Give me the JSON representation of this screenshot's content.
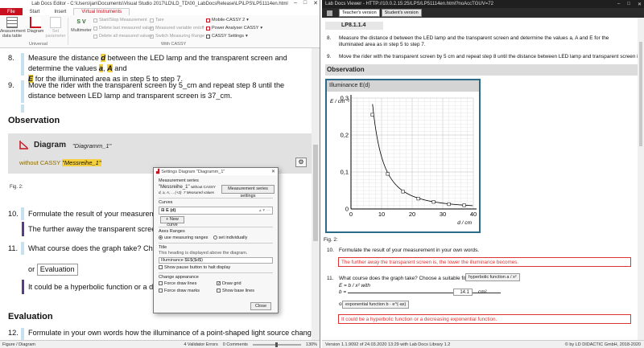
{
  "editor": {
    "title": "Lab Docs Editor - C:\\Users\\jan\\Documents\\Visual Studio 2017\\LD\\LD_TD\\00_LabDocsRelease\\LP\\LPS\\LP51114en.html",
    "tabs": [
      {
        "label": "File"
      },
      {
        "label": "Start"
      },
      {
        "label": "Insert"
      },
      {
        "label": "Virtual Instruments"
      }
    ],
    "ribbon": {
      "measurement_data_table": "Measurement data table",
      "diagram": "Diagram",
      "set_parameter": "Set parameter",
      "universal": "Universal",
      "multimeter": "Multimeter",
      "sv_label": "S V",
      "start_stop": "Start/Stop Measurement",
      "delete_last": "Delete last measured value",
      "delete_all": "Delete all measured values",
      "tare": "Tare",
      "measured_variable": "Measured variable on/off",
      "switch_range": "Switch Measuring Range",
      "with_cassy": "With CASSY",
      "mobile_cassy": "Mobile-CASSY 2",
      "power_analyser": "Power Analyser CASSY",
      "cassy_settings": "CASSY Settings"
    },
    "content": {
      "step8_num": "8.",
      "step8_pre": "Measure the distance ",
      "step8_d": "d",
      "step8_mid": " between the LED lamp and the transparent screen and determine the values ",
      "step8_a": "a",
      "step8_comma": ", ",
      "step8_A": "A",
      "step8_and": " and",
      "step8_E": "E",
      "step8_post": " for the illuminated area as in step 5 to step 7.",
      "step9_num": "9.",
      "step9_text": "Move the rider with the transparent screen by 5_cm and repeat step 8 until the distance between LED lamp and transparent screen is 37_cm.",
      "observation": "Observation",
      "diagram_title": "Diagram",
      "diagram_name": "\"Diagramm_1\"",
      "without_cassy": "without CASSY",
      "messreihe": "\"Messreihe_1\"",
      "fig2": "Fig. 2:",
      "step10_num": "10.",
      "step10_text": "Formulate the result of your measurement in y",
      "step10_answer": "The further away the transparent screen is, the",
      "step11_num": "11.",
      "step11_text": "What course does the graph take? Choose a su",
      "or_label": "or",
      "evaluation_box": "Evaluation",
      "step11_answer": "It could be a hyperbolic function or a decreasing",
      "evaluation": "Evaluation",
      "step12_num": "12.",
      "step12_text": "Formulate in your own words how the illuminance of a point-shaped light source changes depending on"
    },
    "status": {
      "left": "Figure / Diagram",
      "validator": "4 Validator Errors",
      "comments": "0 Comments",
      "zoom": "130%"
    }
  },
  "dialog": {
    "title": "Settings Diagram \"Diagramm_1\"",
    "measurement_series": "Measurement series",
    "series_name": "\"Messreihe_1\"",
    "series_without": "without CASSY",
    "series_vars": "d, a, A, ... (+2)",
    "series_count": "7 Measured values",
    "series_button": "Measurement series settings",
    "curves": "Curves",
    "curve_item": "E (d)",
    "new_curve": "+ New curve",
    "axes_ranges": "Axes Ranges",
    "use_ranges": "use measuring ranges",
    "set_individually": "set individually",
    "title_label": "Title",
    "title_hint": "This heading is displayed above the diagram.",
    "title_value": "Illuminance $E$($d$)",
    "show_pause": "Show pause button to halt display",
    "change_appearance": "Change appearance",
    "force_lines": "Force draw lines",
    "force_marks": "Force draw marks",
    "draw_grid": "Draw grid",
    "show_base": "Show base lines",
    "close": "Close"
  },
  "viewer": {
    "title": "Lab Docs Viewer - HTTP://10.0.2.15:25/LPS/LP51114en.html?noAccTGUV=72",
    "teacher_version": "Teacher's version",
    "student_version": "Student's version",
    "lp_number": "LP8.1.1.4",
    "step8_num": "8.",
    "step8_text": "Measure the distance d between the LED lamp and the transparent screen and determine the values a, A and E for the illuminated area as in step 5 to step 7.",
    "step9_num": "9.",
    "step9_text": "Move the rider with the transparent screen by 5 cm and repeat step 8 until the distance between LED lamp and transparent screen is 37 cm",
    "observation": "Observation",
    "chart_title": "Illuminance E(d)",
    "fig2": "Fig. 2:",
    "step10_num": "10.",
    "step10_text": "Formulate the result of your measurement in your own words.",
    "step10_answer": "The further away the transparent screen is, the lower the illuminance becomes.",
    "step11_num": "11.",
    "step11_text": "What course does the graph take? Choose a suitable fitting",
    "fit_button": "hyperbolic function a / x²",
    "formula": "E = b / x²  with",
    "b_label": "b =",
    "b_value": "14.1",
    "b_unit": "cm²",
    "or_label": "or",
    "exp_button": "exponential function b · e^(-ax)",
    "step11_answer": "It could be a hyperbolic function or a decreasing exponential function.",
    "status_left": "Version 1.1.9092 of 24.03.2020 13:29 with Lab Docs Library 1.2",
    "status_right": "© by LD DIDACTIC GmbH, 2018-2020"
  },
  "chart_data": {
    "type": "scatter",
    "title": "Illuminance E(d)",
    "xlabel": "d / cm",
    "ylabel": "E / cm⁻²",
    "xlim": [
      0,
      40
    ],
    "ylim": [
      0,
      0.3
    ],
    "x_ticks": [
      0,
      10,
      20,
      30,
      40
    ],
    "y_ticks": [
      0,
      0.1,
      0.2,
      0.3
    ],
    "y_tick_labels": [
      "0",
      "0,1",
      "0,2",
      "0,3"
    ],
    "grid": true,
    "points": [
      {
        "x": 7,
        "y": 0.255
      },
      {
        "x": 12,
        "y": 0.095
      },
      {
        "x": 17,
        "y": 0.047
      },
      {
        "x": 22,
        "y": 0.028
      },
      {
        "x": 27,
        "y": 0.019
      },
      {
        "x": 32,
        "y": 0.013
      },
      {
        "x": 37,
        "y": 0.01
      }
    ],
    "fit": {
      "type": "hyperbolic",
      "b": 14.1,
      "color": "#000000"
    },
    "colors": {
      "frame": "#2c6a8a",
      "accent": "#c8101e",
      "answer_red": "#dd3333"
    }
  }
}
